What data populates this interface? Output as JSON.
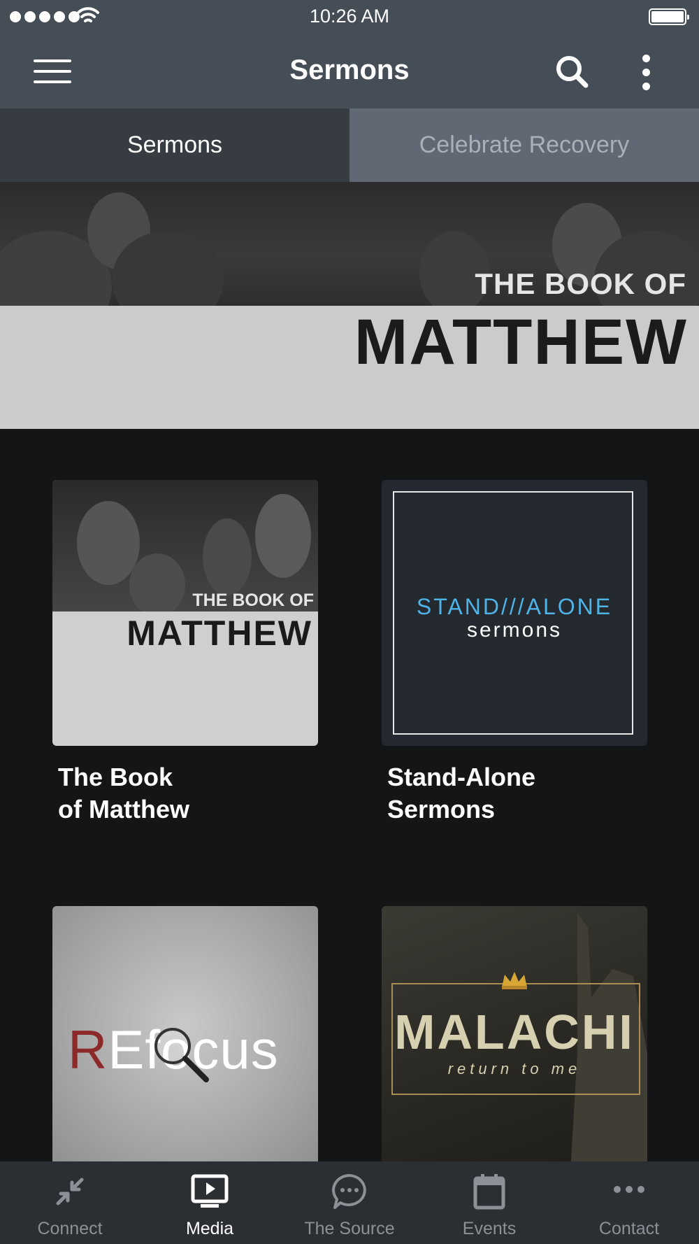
{
  "status_bar": {
    "time": "10:26 AM"
  },
  "nav": {
    "title": "Sermons"
  },
  "tabs": [
    {
      "label": "Sermons",
      "active": true
    },
    {
      "label": "Celebrate Recovery",
      "active": false
    }
  ],
  "hero": {
    "line1": "THE BOOK OF",
    "line2": "MATTHEW"
  },
  "series": [
    {
      "title_lines": [
        "The Book",
        "of Matthew"
      ],
      "artwork_text": [
        "THE BOOK OF",
        "MATTHEW"
      ]
    },
    {
      "title_lines": [
        "Stand-Alone",
        "Sermons"
      ],
      "artwork_text": [
        "STAND///ALONE",
        "sermons"
      ]
    },
    {
      "artwork_text": [
        "R",
        "Efocus"
      ]
    },
    {
      "artwork_text": [
        "MALACHI",
        "return to me"
      ]
    }
  ],
  "bottom_tabs": [
    {
      "label": "Connect",
      "icon": "connect-arrows-icon",
      "active": false
    },
    {
      "label": "Media",
      "icon": "play-screen-icon",
      "active": true
    },
    {
      "label": "The Source",
      "icon": "chat-bubble-icon",
      "active": false
    },
    {
      "label": "Events",
      "icon": "calendar-icon",
      "active": false
    },
    {
      "label": "Contact",
      "icon": "ellipsis-icon",
      "active": false
    }
  ],
  "colors": {
    "bar_background": "#454e57",
    "page_background": "#141517",
    "tab_active": "#373c43",
    "tab_inactive": "#5f6873",
    "accent_blue": "#4fb3e8"
  }
}
